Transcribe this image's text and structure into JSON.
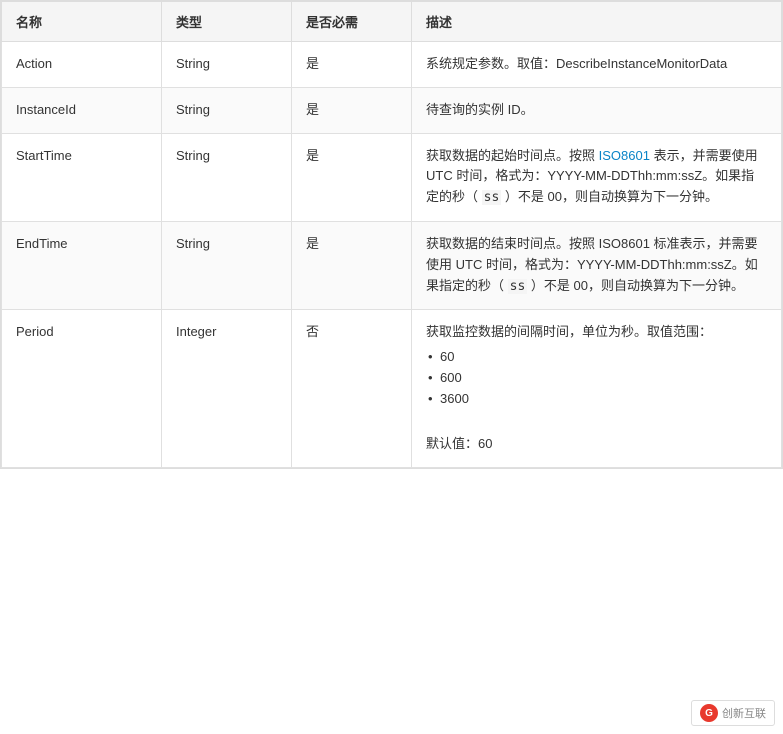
{
  "table": {
    "headers": {
      "name": "名称",
      "type": "类型",
      "required": "是否必需",
      "description": "描述"
    },
    "rows": [
      {
        "name": "Action",
        "type": "String",
        "required": "是",
        "description_parts": [
          {
            "text": "系统规定参数。取值：DescribeInstanceMonitorData",
            "link": null
          }
        ],
        "description_plain": "系统规定参数。取值：DescribeInstanceMonitorData"
      },
      {
        "name": "InstanceId",
        "type": "String",
        "required": "是",
        "description_plain": "待查询的实例 ID。"
      },
      {
        "name": "StartTime",
        "type": "String",
        "required": "是",
        "description_has_link": true,
        "description_link_text": "ISO8601",
        "description_before_link": "获取数据的起始时间点。按照 ",
        "description_after_link": " 表示，并需要使用 UTC 时间，格式为：YYYY-MM-DDThh:mm:ssZ。如果指定的秒（ ",
        "description_code": "ss",
        "description_after_code": " ）不是 00，则自动换算为下一分钟。"
      },
      {
        "name": "EndTime",
        "type": "String",
        "required": "是",
        "description_endtime": "获取数据的结束时间点。按照 ISO8601 标准表示，并需要使用 UTC 时间，格式为：YYYY-MM-DDThh:mm:ssZ。如果指定的秒（ ss ）不是 00，则自动换算为下一分钟。"
      },
      {
        "name": "Period",
        "type": "Integer",
        "required": "否",
        "description_period_intro": "获取监控数据的间隔时间，单位为秒。取值范围：",
        "description_period_values": [
          "60",
          "600",
          "3600"
        ],
        "description_period_default": "默认值：60"
      }
    ]
  },
  "watermark": {
    "text": "创新互联",
    "icon": "G"
  }
}
